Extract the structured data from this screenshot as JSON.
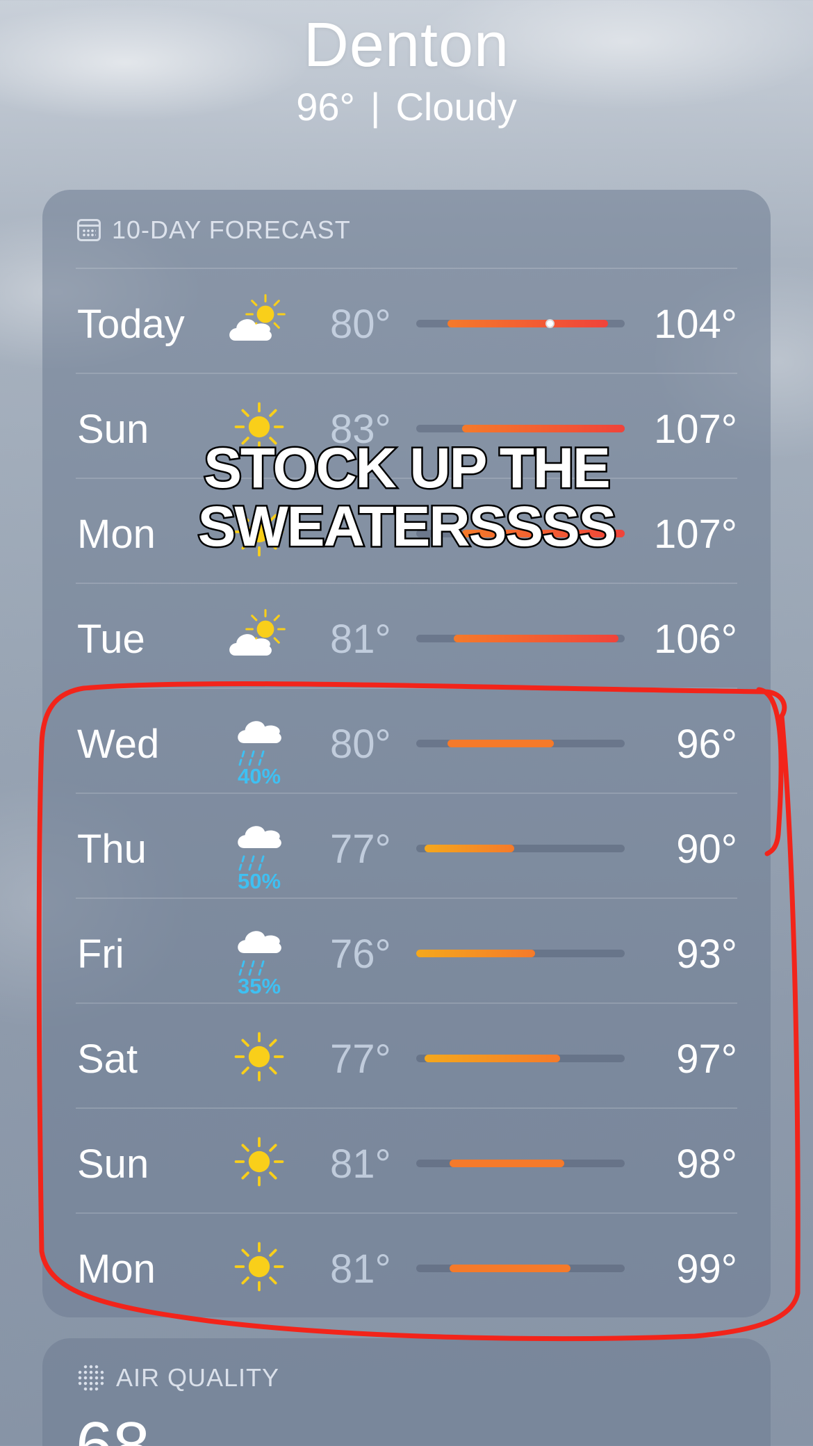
{
  "location": {
    "city": "Denton",
    "current_temp": "96°",
    "separator": "|",
    "condition": "Cloudy"
  },
  "forecast": {
    "header": "10-DAY FORECAST",
    "days": [
      {
        "day": "Today",
        "icon": "partly-cloudy-day-icon",
        "low": "80°",
        "high": "104°",
        "precip": "",
        "bar_start": 0.15,
        "bar_end": 0.92,
        "current_position": 0.64
      },
      {
        "day": "Sun",
        "icon": "sun-icon",
        "low": "83°",
        "high": "107°",
        "precip": "",
        "bar_start": 0.22,
        "bar_end": 1.0
      },
      {
        "day": "Mon",
        "icon": "sun-icon",
        "low": "",
        "high": "107°",
        "precip": "",
        "bar_start": 0.22,
        "bar_end": 1.0
      },
      {
        "day": "Tue",
        "icon": "partly-cloudy-day-icon",
        "low": "81°",
        "high": "106°",
        "precip": "",
        "bar_start": 0.18,
        "bar_end": 0.97
      },
      {
        "day": "Wed",
        "icon": "rain-cloud-icon",
        "low": "80°",
        "high": "96°",
        "precip": "40%",
        "bar_start": 0.15,
        "bar_end": 0.66
      },
      {
        "day": "Thu",
        "icon": "rain-cloud-icon",
        "low": "77°",
        "high": "90°",
        "precip": "50%",
        "bar_start": 0.04,
        "bar_end": 0.47
      },
      {
        "day": "Fri",
        "icon": "rain-cloud-icon",
        "low": "76°",
        "high": "93°",
        "precip": "35%",
        "bar_start": 0.0,
        "bar_end": 0.57
      },
      {
        "day": "Sat",
        "icon": "sun-icon",
        "low": "77°",
        "high": "97°",
        "precip": "",
        "bar_start": 0.04,
        "bar_end": 0.69
      },
      {
        "day": "Sun",
        "icon": "sun-icon",
        "low": "81°",
        "high": "98°",
        "precip": "",
        "bar_start": 0.16,
        "bar_end": 0.71
      },
      {
        "day": "Mon",
        "icon": "sun-icon",
        "low": "81°",
        "high": "99°",
        "precip": "",
        "bar_start": 0.16,
        "bar_end": 0.74
      }
    ]
  },
  "overlay_caption": "STOCK UP THE SWEATERSSSS",
  "air_quality": {
    "header": "AIR QUALITY",
    "value": "68"
  },
  "colors": {
    "hot": "#f0433a",
    "warm": "#f57a2a",
    "mild": "#f5a81c",
    "rain": "#3fc0f2",
    "sun": "#f9cf1a"
  }
}
